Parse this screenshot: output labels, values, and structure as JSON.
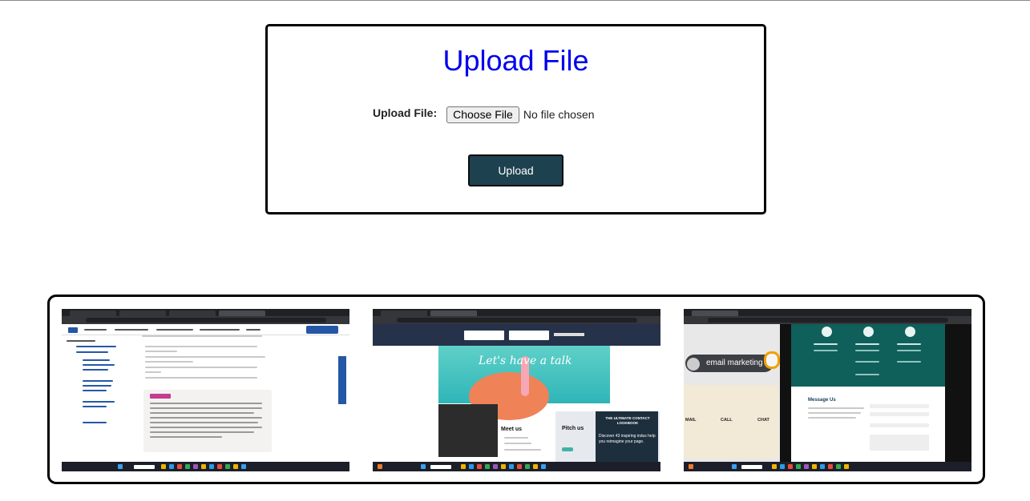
{
  "upload_form": {
    "title": "Upload File",
    "field_label": "Upload File:",
    "choose_button": "Choose File",
    "no_file_text": "No file chosen",
    "submit_button": "Upload"
  },
  "colors": {
    "title": "#0000ee",
    "upload_button_bg": "#1e4150",
    "border": "#000000"
  },
  "gallery": {
    "thumbnails": [
      {
        "name": "thumbnail-indeed-interview-questions",
        "quote_tag": "Example:"
      },
      {
        "name": "thumbnail-contact-page-flamingo",
        "hero_text": "Let's have a talk",
        "meet_text": "Meet us",
        "pitch_text": "Pitch us",
        "lookbook_title": "THE ULTIMATE CONTACT LOOKBOOK",
        "lookbook_text": "Discover 43 inspiring indus help you reimagine your page."
      },
      {
        "name": "thumbnail-email-marketing-contact",
        "chip_text": "email marketing",
        "labels": [
          "MAIL",
          "CALL",
          "CHAT"
        ],
        "message_heading": "Message Us"
      }
    ]
  }
}
